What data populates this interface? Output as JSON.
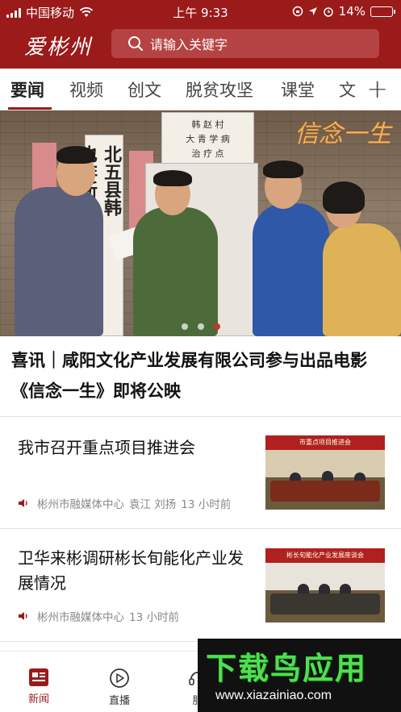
{
  "status_bar": {
    "carrier": "中国移动",
    "time": "上午 9:33",
    "battery": "14%",
    "battery_level": 0.14
  },
  "header": {
    "logo_text": "爱彬州",
    "search_placeholder": "请输入关键字"
  },
  "tabs": [
    {
      "label": "要闻",
      "active": true
    },
    {
      "label": "视频"
    },
    {
      "label": "创文"
    },
    {
      "label": "脱贫攻坚"
    },
    {
      "label": "课堂"
    },
    {
      "label": "文"
    }
  ],
  "tab_add": "+",
  "hero": {
    "signs": {
      "top": "韩 赵 村\n大 青 学 病\n治 疗 点",
      "left": "北五县韩\n也非新",
      "overlay": "信念一生"
    },
    "carousel": {
      "total": 3,
      "active_index": 2
    }
  },
  "headline": "喜讯｜咸阳文化产业发展有限公司参与出品电影《信念一生》即将公映",
  "news": [
    {
      "title": "我市召开重点项目推进会",
      "source": "彬州市融媒体中心",
      "authors": "袁江  刘扬",
      "time": "13 小时前",
      "thumb_banner": "市重点项目推进会"
    },
    {
      "title": "卫华来彬调研彬长旬能化产业发展情况",
      "source": "彬州市融媒体中心",
      "authors": "",
      "time": "13 小时前",
      "thumb_banner": "彬长旬能化产业发展座谈会"
    }
  ],
  "bottom_nav": [
    {
      "label": "新闻",
      "icon": "news-icon",
      "active": true
    },
    {
      "label": "直播",
      "icon": "play-icon"
    },
    {
      "label": "服",
      "icon": "service-icon"
    }
  ],
  "watermark": {
    "title": "下载鸟应用",
    "url": "www.xiazainiao.com"
  },
  "colors": {
    "brand": "#9b1a1a",
    "search_bg": "#b54343",
    "active_dot": "#c0392b",
    "watermark_green": "#4ee04e"
  }
}
